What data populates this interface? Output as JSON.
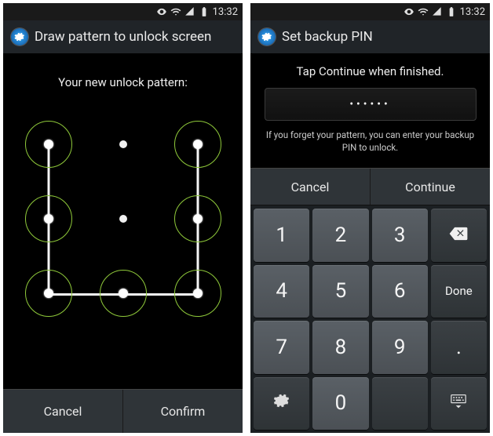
{
  "status": {
    "time": "13:32"
  },
  "screenA": {
    "title": "Draw pattern to unlock screen",
    "prompt": "Your new unlock pattern:",
    "cancel": "Cancel",
    "confirm": "Confirm",
    "pattern_active_cells": [
      0,
      2,
      3,
      5,
      6,
      7,
      8
    ],
    "pattern_path_order": [
      0,
      3,
      6,
      7,
      8,
      5,
      2
    ]
  },
  "screenB": {
    "title": "Set backup PIN",
    "prompt": "Tap Continue when finished.",
    "pin_masked": "••••••",
    "note": "If you forget your pattern, you can enter your backup PIN to unlock.",
    "cancel": "Cancel",
    "continue": "Continue",
    "keys": {
      "k1": "1",
      "k2": "2",
      "k3": "3",
      "k4": "4",
      "k5": "5",
      "k6": "6",
      "k7": "7",
      "k8": "8",
      "k9": "9",
      "k0": "0",
      "done": "Done",
      "dot": "."
    }
  }
}
